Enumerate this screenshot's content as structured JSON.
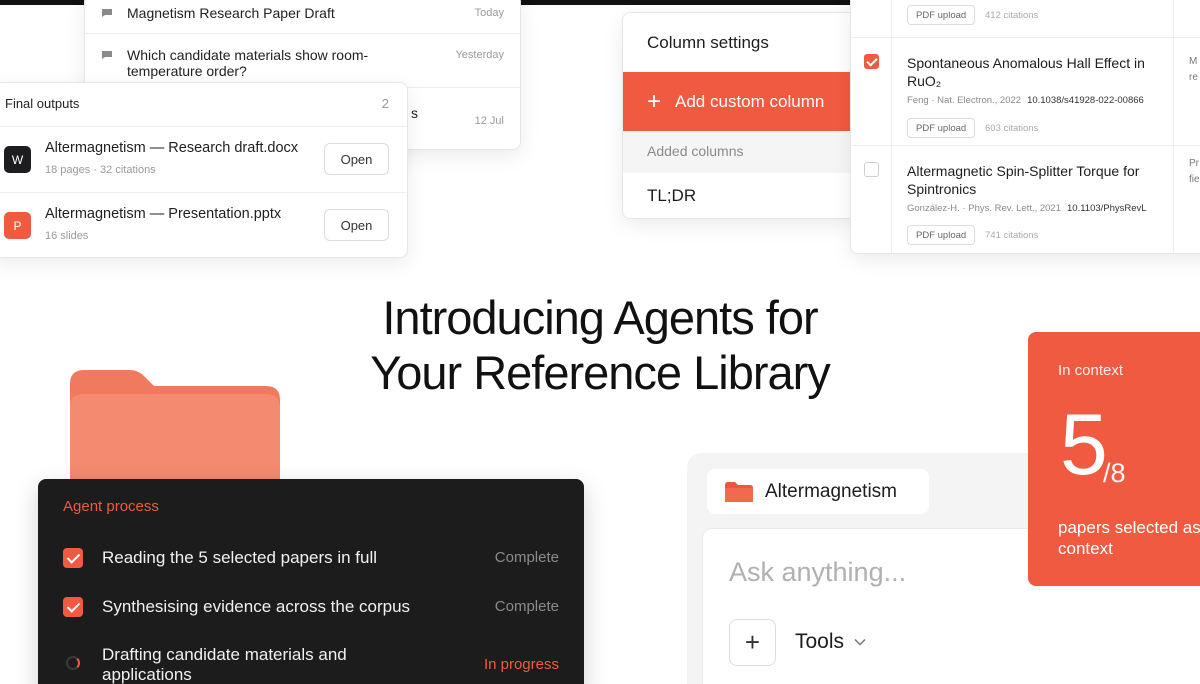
{
  "colors": {
    "accent": "#f05a40",
    "dark_panel": "#1c1c1c"
  },
  "chat_list": {
    "items": [
      {
        "title": "Magnetism Research Paper Draft",
        "date": "Today"
      },
      {
        "title": "Which candidate materials show room-temperature order?",
        "date": "Yesterday"
      },
      {
        "title": "s",
        "date": "12 Jul"
      }
    ]
  },
  "final_outputs": {
    "title": "Final outputs",
    "count": "2",
    "files": [
      {
        "icon_letter": "W",
        "icon": "word-document-icon",
        "name": "Altermagnetism — Research draft.docx",
        "meta": "18 pages · 32 citations",
        "action": "Open"
      },
      {
        "icon_letter": "P",
        "icon": "presentation-icon",
        "name": "Altermagnetism — Presentation.pptx",
        "meta": "16 slides",
        "action": "Open"
      }
    ]
  },
  "column_settings": {
    "title": "Column settings",
    "add_label": "Add custom column",
    "added_columns_label": "Added columns",
    "columns": [
      "TL;DR"
    ]
  },
  "papers": {
    "rows": [
      {
        "checked": false,
        "pdf_tag": "PDF upload",
        "citations": "412 citations"
      },
      {
        "checked": true,
        "title": "Spontaneous Anomalous Hall Effect in RuO₂",
        "authors": "Feng · Nat. Electron., 2022",
        "doi": "10.1038/s41928-022-00866",
        "pdf_tag": "PDF upload",
        "citations": "603 citations",
        "extra": "M\nre"
      },
      {
        "checked": false,
        "title": "Altermagnetic Spin-Splitter Torque for Spintronics",
        "authors": "González-H. · Phys. Rev. Lett., 2021",
        "doi": "10.1103/PhysRevL",
        "pdf_tag": "PDF upload",
        "citations": "741 citations",
        "extra": "Pr\nfie"
      }
    ]
  },
  "headline": {
    "line1": "Introducing Agents for",
    "line2": "Your Reference Library"
  },
  "agent_process": {
    "title": "Agent process",
    "steps": [
      {
        "label": "Reading the 5 selected papers in full",
        "status": "Complete",
        "state": "done"
      },
      {
        "label": "Synthesising evidence across the corpus",
        "status": "Complete",
        "state": "done"
      },
      {
        "label": "Drafting candidate materials and applications",
        "status": "In progress",
        "state": "running"
      }
    ]
  },
  "ask": {
    "library_name": "Altermagnetism",
    "placeholder": "Ask anything...",
    "plus_label": "+",
    "tools_label": "Tools"
  },
  "context": {
    "label": "In context",
    "selected": "5",
    "total": "/8",
    "description": "papers selected as context"
  }
}
